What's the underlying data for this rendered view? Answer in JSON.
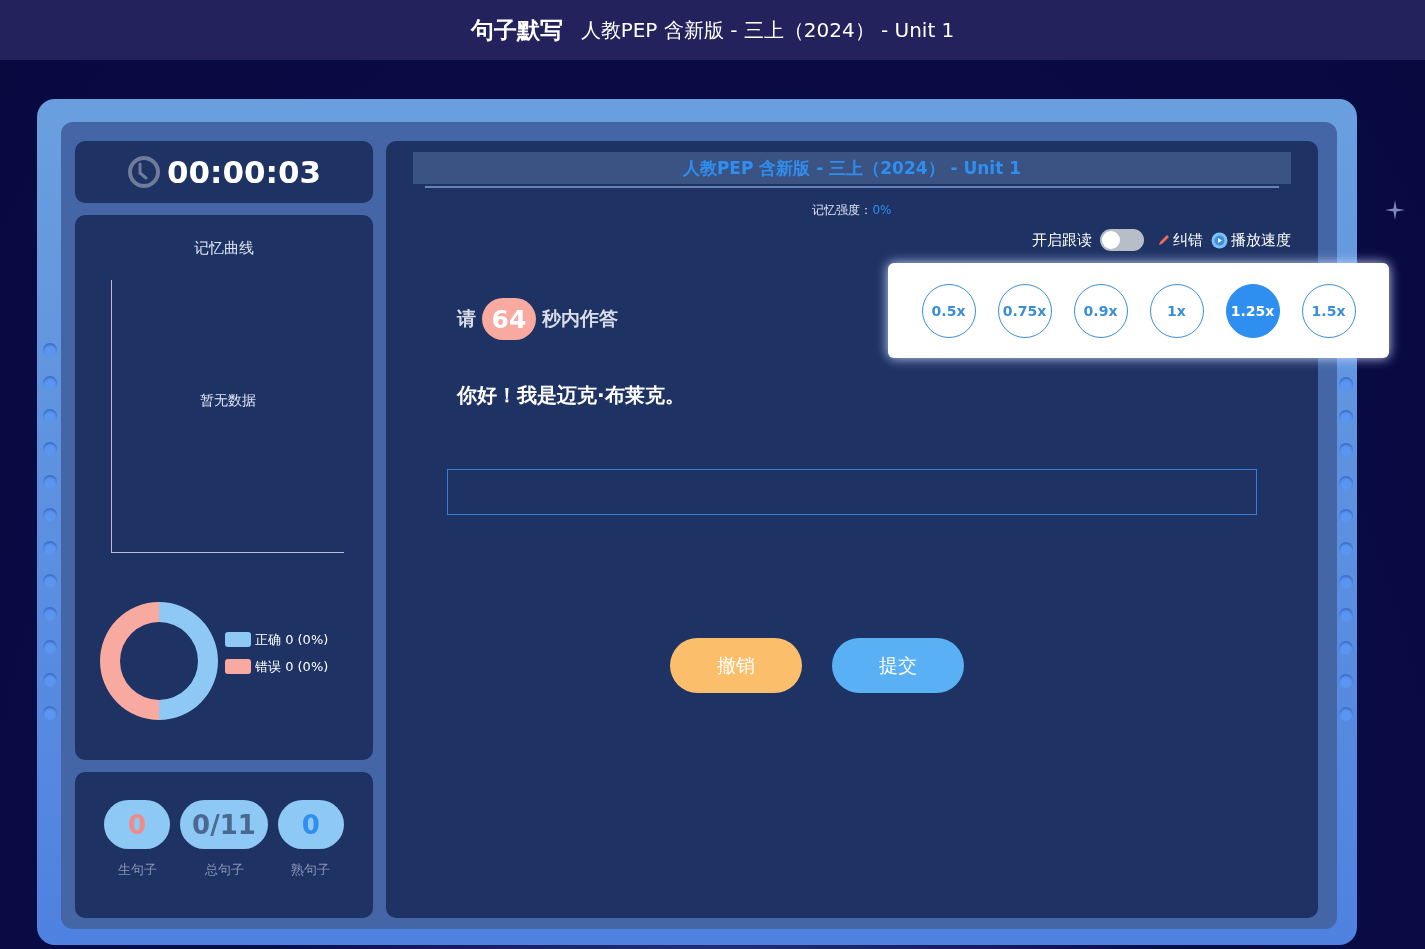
{
  "header": {
    "title": "句子默写",
    "subtitle": "人教PEP 含新版 - 三上（2024） - Unit 1"
  },
  "timer": "00:00:03",
  "memory_curve": {
    "title": "记忆曲线",
    "empty_text": "暂无数据"
  },
  "legend": [
    {
      "label": "正确 0 (0%)",
      "color": "#8ec8f5"
    },
    {
      "label": "错误 0 (0%)",
      "color": "#f8a9a0"
    }
  ],
  "stats": [
    {
      "value": "0",
      "label": "生句子",
      "kind": "new"
    },
    {
      "value": "0/11",
      "label": "总句子",
      "kind": "total"
    },
    {
      "value": "0",
      "label": "熟句子",
      "kind": "known"
    }
  ],
  "main": {
    "title": "人教PEP 含新版 - 三上（2024） - Unit 1",
    "strength_label": "记忆强度：",
    "strength_value": "0%"
  },
  "controls": {
    "follow_label": "开启跟读",
    "follow_on": false,
    "correct_label": "纠错",
    "speed_label": "播放速度"
  },
  "speed_options": [
    {
      "label": "0.5x",
      "selected": false
    },
    {
      "label": "0.75x",
      "selected": false
    },
    {
      "label": "0.9x",
      "selected": false
    },
    {
      "label": "1x",
      "selected": false
    },
    {
      "label": "1.25x",
      "selected": true
    },
    {
      "label": "1.5x",
      "selected": false
    }
  ],
  "prompt": {
    "before": "请",
    "seconds": "64",
    "after": "秒内作答"
  },
  "sentence": "你好！我是迈克·布莱克。",
  "buttons": [
    {
      "label": "撤销",
      "kind": "undo"
    },
    {
      "label": "提交",
      "kind": "submit"
    }
  ]
}
